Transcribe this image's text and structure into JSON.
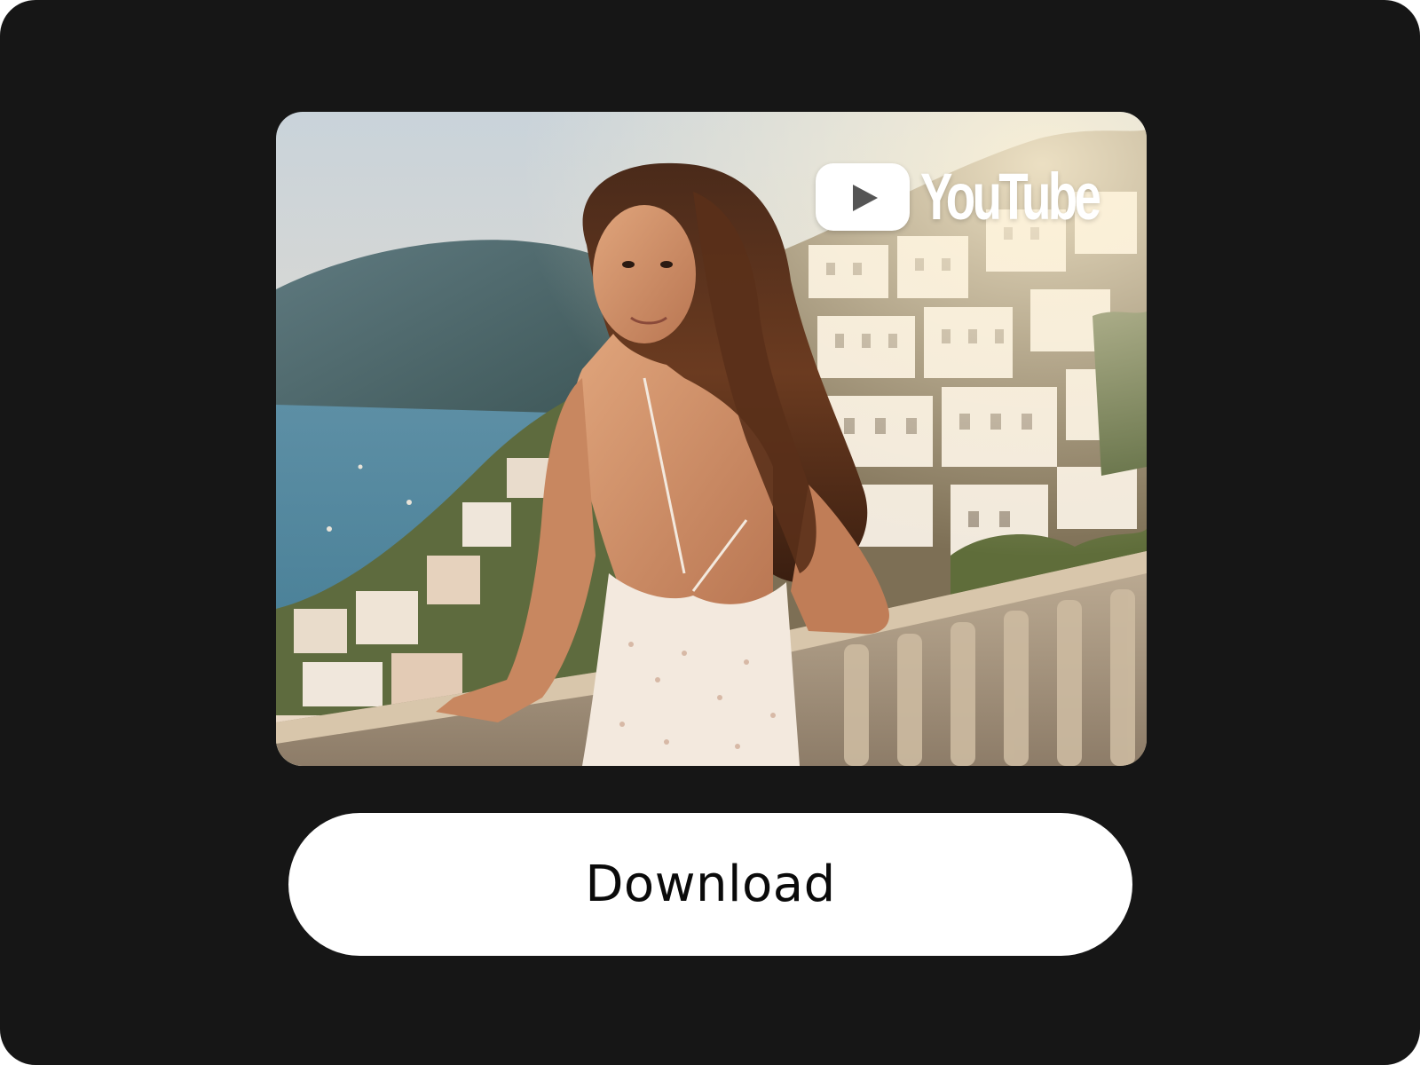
{
  "thumbnail": {
    "icon": "scenic-photo",
    "watermark": {
      "icon": "youtube-play-icon",
      "brand": "YouTube"
    }
  },
  "actions": {
    "download_label": "Download"
  },
  "colors": {
    "background": "#161616",
    "button_bg": "#ffffff",
    "button_text": "#0a0a0a"
  }
}
